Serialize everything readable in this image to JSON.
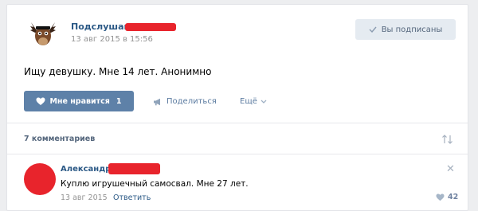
{
  "post": {
    "group_name": "Подслушано",
    "date": "13 авг 2015 в 15:56",
    "text": "Ищу девушку. Мне 14 лет. Анонимно",
    "subscribe_label": "Вы подписаны"
  },
  "actions": {
    "like_label": "Мне нравится",
    "like_count": "1",
    "share_label": "Поделиться",
    "more_label": "Ещё"
  },
  "comments": {
    "count_label": "7 комментариев",
    "items": [
      {
        "author": "Александр",
        "text": "Куплю игрушечный самосвал. Мне 27 лет.",
        "date": "13 авг 2015",
        "reply_label": "Ответить",
        "likes": "42"
      }
    ]
  },
  "colors": {
    "accent": "#2a5885",
    "like_button": "#5e81a8",
    "redaction": "#e8242c"
  },
  "icons": [
    "moose-logo-icon",
    "check-icon",
    "heart-icon",
    "megaphone-icon",
    "chevron-down-icon",
    "sort-icon",
    "close-icon"
  ]
}
